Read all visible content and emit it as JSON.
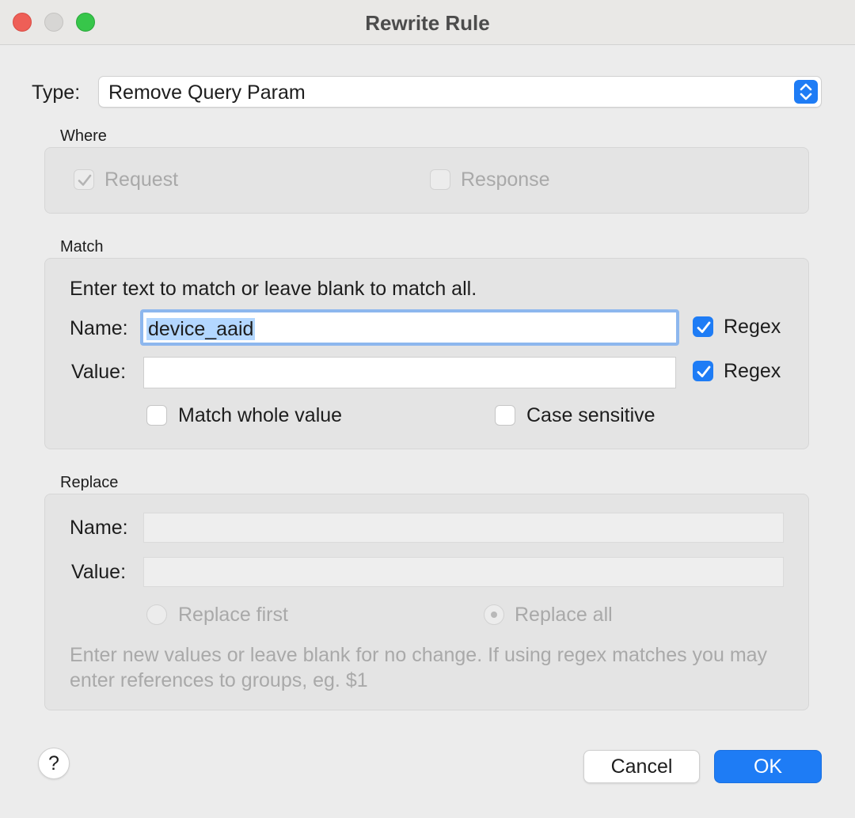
{
  "window": {
    "title": "Rewrite Rule"
  },
  "type": {
    "label": "Type:",
    "value": "Remove Query Param"
  },
  "where": {
    "title": "Where",
    "request": {
      "label": "Request",
      "checked": true,
      "enabled": false
    },
    "response": {
      "label": "Response",
      "checked": false,
      "enabled": false
    }
  },
  "match": {
    "title": "Match",
    "instructions": "Enter text to match or leave blank to match all.",
    "name_label": "Name:",
    "name_value": "device_aaid",
    "name_regex_label": "Regex",
    "name_regex_checked": true,
    "value_label": "Value:",
    "value_value": "",
    "value_regex_label": "Regex",
    "value_regex_checked": true,
    "match_whole_label": "Match whole value",
    "match_whole_checked": false,
    "case_sensitive_label": "Case sensitive",
    "case_sensitive_checked": false
  },
  "replace": {
    "title": "Replace",
    "name_label": "Name:",
    "name_value": "",
    "value_label": "Value:",
    "value_value": "",
    "replace_first_label": "Replace first",
    "replace_all_label": "Replace all",
    "selected": "Replace all",
    "note": "Enter new values or leave blank for no change. If using regex matches you may enter references to groups, eg. $1"
  },
  "buttons": {
    "help": "?",
    "cancel": "Cancel",
    "ok": "OK"
  },
  "colors": {
    "accent": "#1e7cf5",
    "disabled_text": "#a9a9a9",
    "close": "#ee5f57",
    "maximize": "#37c64a"
  },
  "icons": [
    "close-dot",
    "minimize-dot",
    "maximize-dot",
    "updown-chevron-icon",
    "checkmark-icon"
  ]
}
